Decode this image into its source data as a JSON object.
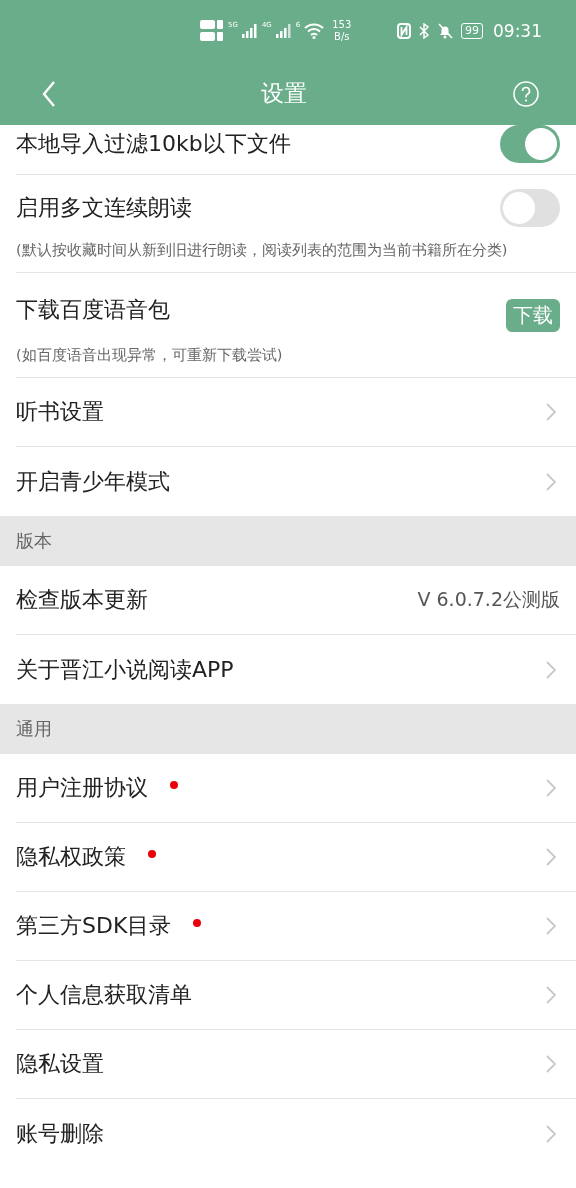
{
  "status_bar": {
    "sim_labels": [
      "5G",
      "4G"
    ],
    "wifi_label": "6",
    "speed_value": "153",
    "speed_unit": "B/s",
    "battery": "99",
    "time": "09:31"
  },
  "header": {
    "title": "设置"
  },
  "groups": [
    {
      "items": [
        {
          "kind": "toggle",
          "label": "本地导入过滤10kb以下文件",
          "on": true
        },
        {
          "kind": "toggle",
          "label": "启用多文连续朗读",
          "on": false,
          "note": "(默认按收藏时间从新到旧进行朗读，阅读列表的范围为当前书籍所在分类)"
        },
        {
          "kind": "download",
          "label": "下载百度语音包",
          "note": "(如百度语音出现异常，可重新下载尝试)",
          "button": "下载"
        },
        {
          "kind": "nav",
          "label": "听书设置"
        },
        {
          "kind": "nav",
          "label": "开启青少年模式"
        }
      ]
    },
    {
      "title": "版本",
      "items": [
        {
          "kind": "value",
          "label": "检查版本更新",
          "value": "V 6.0.7.2公测版"
        },
        {
          "kind": "nav",
          "label": "关于晋江小说阅读APP"
        }
      ]
    },
    {
      "title": "通用",
      "items": [
        {
          "kind": "nav",
          "label": "用户注册协议",
          "dot": true
        },
        {
          "kind": "nav",
          "label": "隐私权政策",
          "dot": true
        },
        {
          "kind": "nav",
          "label": "第三方SDK目录",
          "dot": true
        },
        {
          "kind": "nav",
          "label": "个人信息获取清单",
          "dot": false
        },
        {
          "kind": "nav",
          "label": "隐私设置",
          "dot": false
        },
        {
          "kind": "nav",
          "label": "账号删除",
          "dot": false
        }
      ]
    }
  ]
}
